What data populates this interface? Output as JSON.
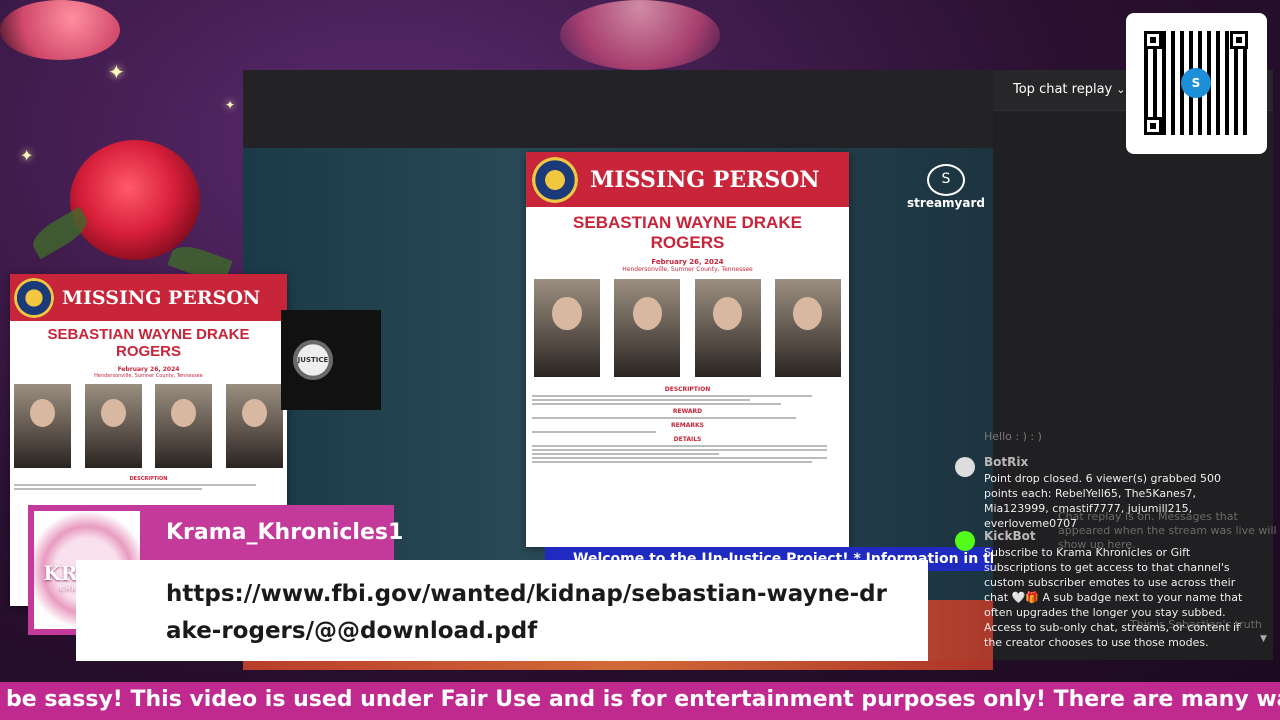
{
  "stream": {
    "streamyard_label": "streamyard",
    "justice_logo": "JUSTICE",
    "welcome_banner": "Welcome to the Un-Justice Project! * Information in this video"
  },
  "flyer": {
    "heading": "MISSING PERSON",
    "name_line1": "SEBASTIAN WAYNE DRAKE",
    "name_line2": "ROGERS",
    "date": "February 26, 2024",
    "location": "Hendersonville, Sumner County, Tennessee",
    "sections": [
      "DESCRIPTION",
      "REWARD",
      "REMARKS",
      "DETAILS"
    ]
  },
  "chat": {
    "title": "Top chat replay",
    "ghost_lines": [
      "Hello : ) : )",
      "Chat replay is on. Messages that",
      "appeared when the stream was live will",
      "show up here.",
      "This is Sebastian's truth"
    ],
    "messages": [
      {
        "user": "BotRix",
        "text": "Point drop closed. 6 viewer(s) grabbed 500 points each: RebelYell65, The5Kanes7, Mia123999, cmastif7777, jujumill215, everloveme0707"
      },
      {
        "user": "KickBot",
        "text": "Subscribe to Krama Khronicles or Gift subscriptions to get access to that channel's custom subscriber emotes to use across their chat 🤍🎁 A sub badge next to your name that often upgrades the longer you stay subbed. Access to sub-only chat, streams, or content if the creator chooses to use those modes."
      }
    ]
  },
  "qr": {
    "center_label": "S"
  },
  "nameplate": {
    "logo_word": "KRAMA",
    "logo_sub": "KHRONICLES",
    "kick_letter": "K",
    "username": "Krama_Khronicles1",
    "url": "https://www.fbi.gov/wanted/kidnap/sebastian-wayne-drake-rogers/@@download.pdf"
  },
  "ticker": {
    "text": "be sassy! This video is used under Fair Use and is for entertainment purposes only! There are many ways to"
  },
  "colors": {
    "brand_pink": "#c33a9a",
    "fbi_red": "#c8243a",
    "banner_blue": "#1f2ac0",
    "kick_green": "#53fc18"
  }
}
